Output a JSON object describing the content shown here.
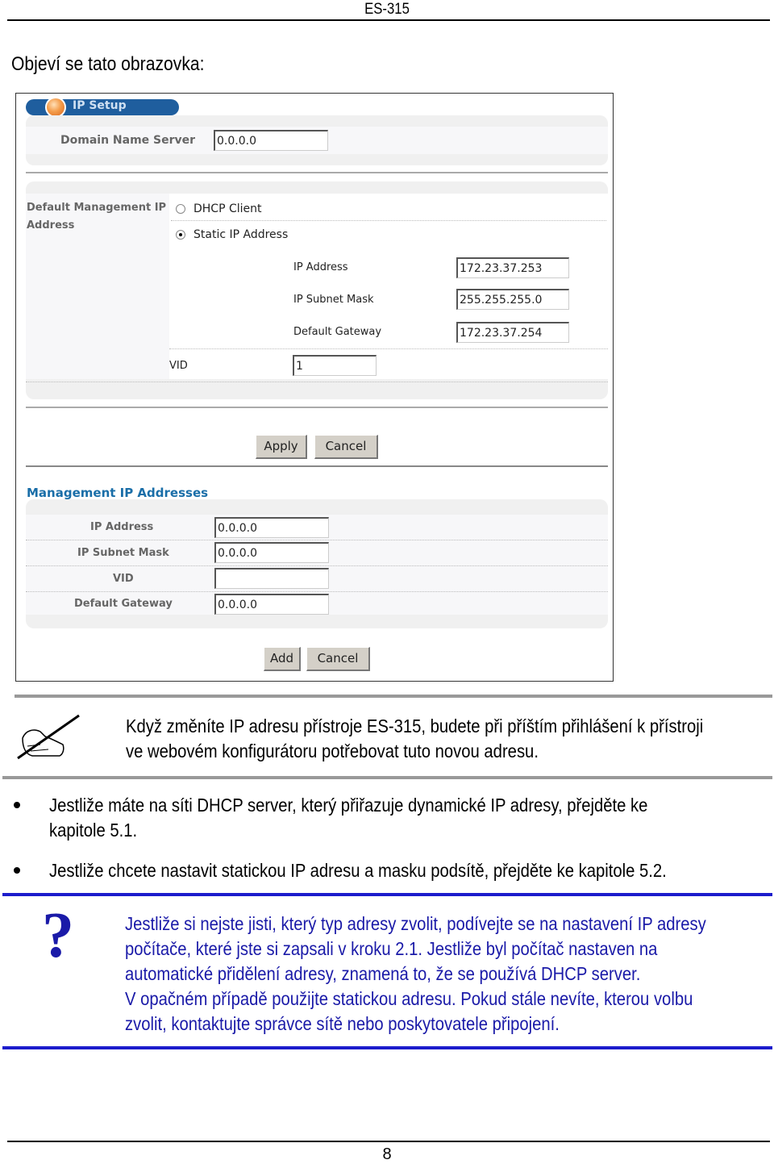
{
  "page_header": {
    "title": "ES-315"
  },
  "intro_text": "Objeví se tato obrazovka:",
  "screenshot": {
    "banner_title": "IP Setup",
    "dns": {
      "label": "Domain Name Server",
      "value": "0.0.0.0"
    },
    "default_mgmt": {
      "label_line1": "Default Management IP",
      "label_line2": "Address",
      "options": [
        {
          "label": "DHCP Client",
          "selected": false
        },
        {
          "label": "Static IP Address",
          "selected": true
        }
      ],
      "ip_address": {
        "label": "IP Address",
        "value": "172.23.37.253"
      },
      "subnet_mask": {
        "label": "IP Subnet Mask",
        "value": "255.255.255.0"
      },
      "gateway": {
        "label": "Default Gateway",
        "value": "172.23.37.254"
      },
      "vid": {
        "label": "VID",
        "value": "1"
      }
    },
    "buttons_top": {
      "apply": "Apply",
      "cancel": "Cancel"
    },
    "mgmt_section": {
      "title": "Management IP Addresses",
      "ip_address": {
        "label": "IP Address",
        "value": "0.0.0.0"
      },
      "subnet_mask": {
        "label": "IP Subnet Mask",
        "value": "0.0.0.0"
      },
      "vid": {
        "label": "VID",
        "value": ""
      },
      "gateway": {
        "label": "Default Gateway",
        "value": "0.0.0.0"
      }
    },
    "buttons_bottom": {
      "add": "Add",
      "cancel": "Cancel"
    }
  },
  "note": {
    "icon": "pen-hand-icon",
    "line1": "Když změníte IP adresu přístroje ES-315, budete při příštím přihlášení k přístroji",
    "line2": "ve webovém konfigurátoru potřebovat tuto novou adresu."
  },
  "bullets": [
    {
      "line1": "Jestliže máte na síti DHCP server, který přiřazuje dynamické IP adresy, přejděte ke",
      "line2": "kapitole 5.1."
    },
    {
      "line1": "Jestliže chcete nastavit statickou IP adresu a masku podsítě, přejděte ke kapitole 5.2."
    }
  ],
  "tip": {
    "icon": "question-mark-icon",
    "lines": [
      "Jestliže si nejste jisti, který typ adresy zvolit, podívejte se na nastavení IP adresy",
      "počítače, které jste si zapsali v kroku 2.1. Jestliže byl počítač nastaven na",
      "automatické přidělení adresy, znamená to, že se používá DHCP server.",
      "V opačném případě použijte statickou adresu. Pokud stále nevíte, kterou volbu",
      "zvolit, kontaktujte správce sítě nebo poskytovatele připojení."
    ]
  },
  "page_footer": {
    "page_number": "8"
  },
  "colors": {
    "blue_rule": "#1c1ccc",
    "tip_text": "#1a1aa8",
    "section_title": "#1a6ea8",
    "banner": "#1f5e9e"
  }
}
